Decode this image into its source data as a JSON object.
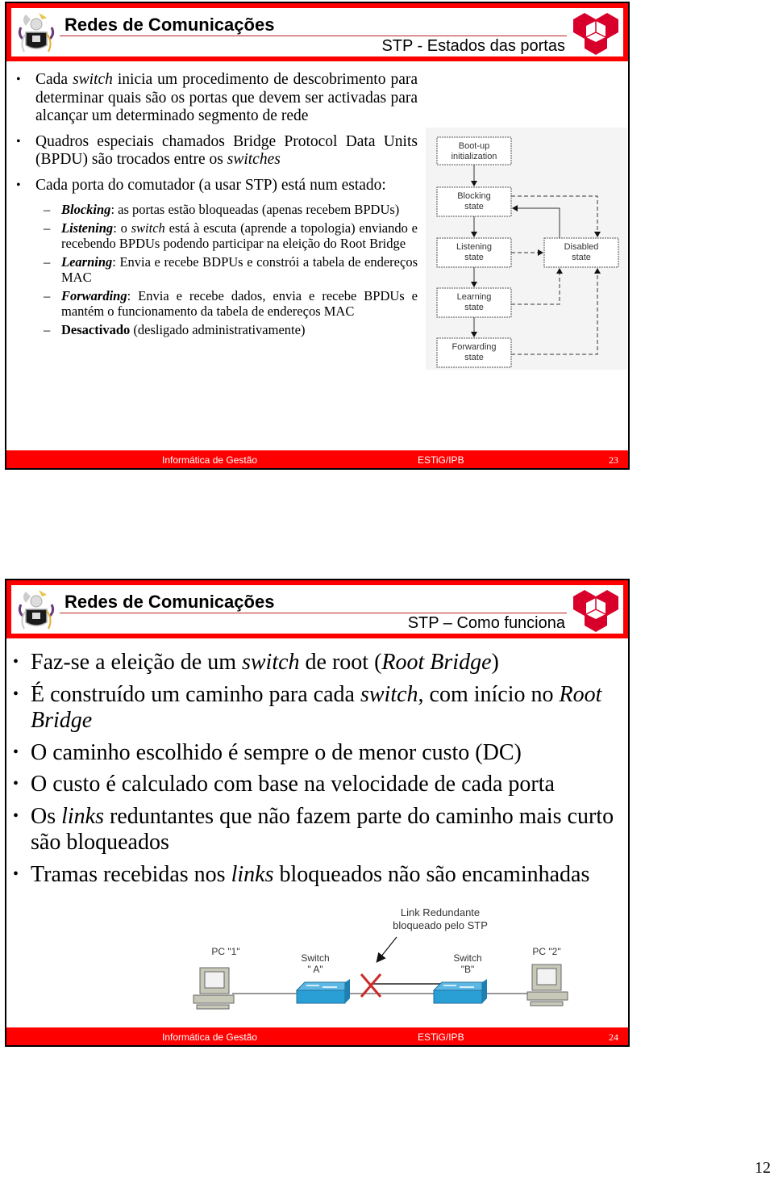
{
  "slides": [
    {
      "title": "Redes de Comunicações",
      "subtitle": "STP - Estados das portas",
      "bullets": [
        {
          "parts": [
            {
              "t": "Cada "
            },
            {
              "t": "switch",
              "i": true
            },
            {
              "t": " inicia um procedimento de descobrimento para determinar quais são os portas que devem ser activadas para alcançar um determinado segmento de rede"
            }
          ]
        },
        {
          "parts": [
            {
              "t": "Quadros especiais chamados Bridge Protocol Data Units (BPDU) são trocados entre os "
            },
            {
              "t": "switches",
              "i": true
            }
          ]
        },
        {
          "parts": [
            {
              "t": "Cada porta do comutador (a usar STP) está num estado:"
            }
          ]
        }
      ],
      "sub_bullets": [
        {
          "parts": [
            {
              "t": "Blocking",
              "bi": true
            },
            {
              "t": ": as portas estão bloqueadas (apenas recebem BPDUs)"
            }
          ]
        },
        {
          "parts": [
            {
              "t": "Listening",
              "bi": true
            },
            {
              "t": ": o "
            },
            {
              "t": "switch",
              "i": true
            },
            {
              "t": " está à escuta (aprende a topologia) enviando e recebendo BPDUs podendo participar na eleição do Root Bridge"
            }
          ]
        },
        {
          "parts": [
            {
              "t": "Learning",
              "bi": true
            },
            {
              "t": ": Envia e recebe BDPUs e constrói a tabela de endereços MAC"
            }
          ]
        },
        {
          "parts": [
            {
              "t": "Forwarding",
              "bi": true
            },
            {
              "t": ": Envia e recebe dados, envia e recebe BPDUs e mantém o funcionamento da tabela de endereços MAC"
            }
          ]
        },
        {
          "parts": [
            {
              "t": "Desactivado",
              "b": true
            },
            {
              "t": " (desligado administrativamente)"
            }
          ]
        }
      ],
      "diagram": {
        "boot": [
          "Boot-up",
          "initialization"
        ],
        "blocking": [
          "Blocking",
          "state"
        ],
        "listening": [
          "Listening",
          "state"
        ],
        "learning": [
          "Learning",
          "state"
        ],
        "forwarding": [
          "Forwarding",
          "state"
        ],
        "disabled": [
          "Disabled",
          "state"
        ]
      },
      "footer": {
        "left": "Informática de Gestão",
        "middle": "ESTiG/IPB",
        "page": "23"
      }
    },
    {
      "title": "Redes de Comunicações",
      "subtitle": "STP – Como funciona",
      "bullets": [
        {
          "parts": [
            {
              "t": "Faz-se a eleição de um "
            },
            {
              "t": "switch",
              "i": true
            },
            {
              "t": " de root ("
            },
            {
              "t": "Root Bridge",
              "i": true
            },
            {
              "t": ")"
            }
          ]
        },
        {
          "parts": [
            {
              "t": "É construído um caminho para cada "
            },
            {
              "t": "switch",
              "i": true
            },
            {
              "t": ", com início no "
            },
            {
              "t": "Root Bridge",
              "i": true
            }
          ]
        },
        {
          "parts": [
            {
              "t": "O caminho escolhido é sempre o de menor custo (DC)"
            }
          ]
        },
        {
          "parts": [
            {
              "t": "O custo é calculado com base na velocidade de cada porta"
            }
          ]
        },
        {
          "parts": [
            {
              "t": "Os "
            },
            {
              "t": "links",
              "i": true
            },
            {
              "t": " reduntantes que não fazem parte do caminho mais curto são bloqueados"
            }
          ]
        },
        {
          "parts": [
            {
              "t": "Tramas recebidas nos "
            },
            {
              "t": "links",
              "i": true
            },
            {
              "t": " bloqueados não são encaminhadas"
            }
          ]
        }
      ],
      "diagram": {
        "callout": [
          "Link Redundante",
          "bloqueado pelo STP"
        ],
        "pc1": "PC \"1\"",
        "switch_a": [
          "Switch",
          "\" A\""
        ],
        "switch_b": [
          "Switch",
          "\"B\""
        ],
        "pc2": "PC \"2\""
      },
      "footer": {
        "left": "Informática de Gestão",
        "middle": "ESTiG/IPB",
        "page": "24"
      }
    }
  ],
  "page_number": "12",
  "colors": {
    "brand_red": "#ff0000",
    "logo_red": "#d8002a",
    "switch_blue": "#2a9fd6",
    "block_x": "#cc2a2a"
  }
}
